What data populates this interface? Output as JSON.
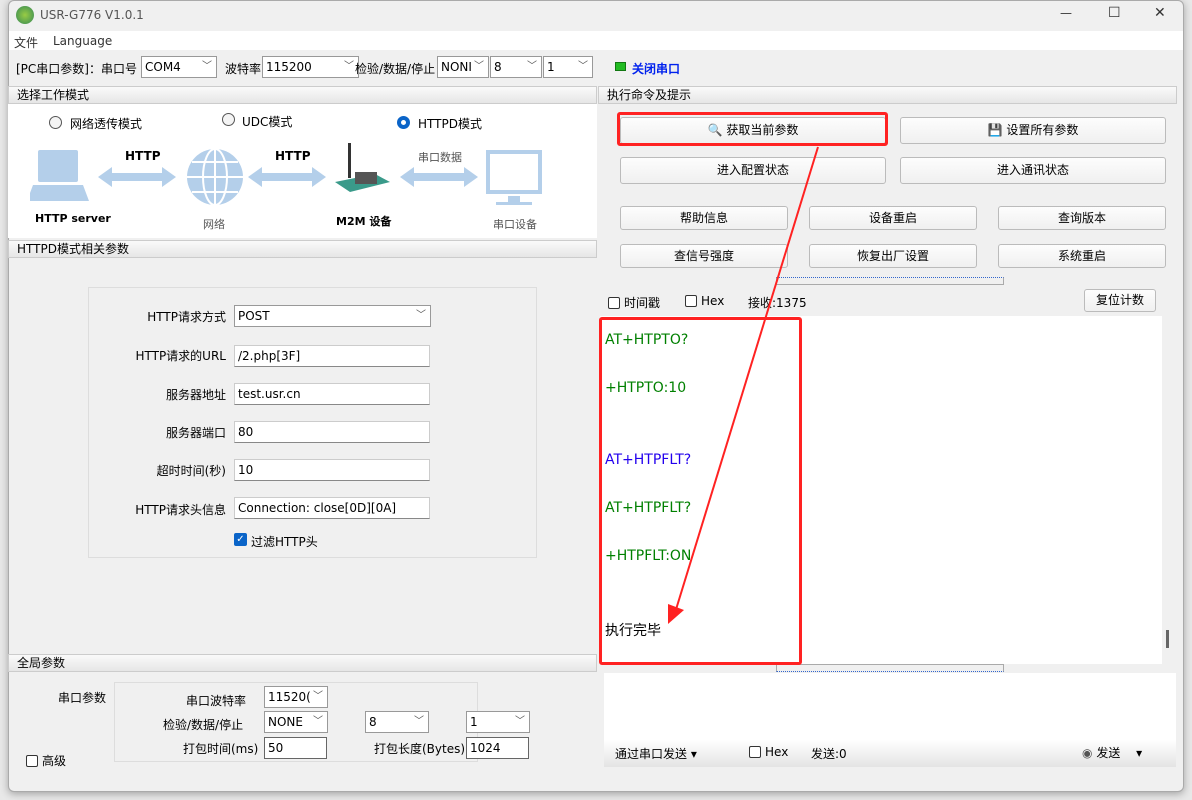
{
  "window": {
    "title": "USR-G776 V1.0.1",
    "controls": [
      "—",
      "☐",
      "✕"
    ]
  },
  "menu": [
    "文件",
    "Language"
  ],
  "toolbar": {
    "pc_label": "[PC串口参数]：串口号",
    "port": "COM4",
    "baud_label": "波特率",
    "baud": "115200",
    "parity_label": "检验/数据/停止",
    "parity": "NONI",
    "data_bits": "8",
    "stop_bits": "1",
    "close_port": "关闭串口",
    "status_color": "#22bb22"
  },
  "mode": {
    "header": "选择工作模式",
    "options": [
      "网络透传模式",
      "UDC模式",
      "HTTPD模式"
    ],
    "selected": "HTTPD模式",
    "diagram": {
      "http1": "HTTP",
      "http2": "HTTP",
      "serial": "串口数据",
      "server": "HTTP server",
      "network": "网络",
      "m2m": "M2M 设备",
      "device": "串口设备"
    }
  },
  "httpd": {
    "header": "HTTPD模式相关参数",
    "fields": [
      {
        "label": "HTTP请求方式",
        "value": "POST",
        "type": "select"
      },
      {
        "label": "HTTP请求的URL",
        "value": "/2.php[3F]"
      },
      {
        "label": "服务器地址",
        "value": "test.usr.cn"
      },
      {
        "label": "服务器端口",
        "value": "80"
      },
      {
        "label": "超时时间(秒)",
        "value": "10"
      },
      {
        "label": "HTTP请求头信息",
        "value": "Connection: close[0D][0A]"
      }
    ],
    "filter_label": "过滤HTTP头",
    "filter_checked": true
  },
  "global": {
    "header": "全局参数",
    "serial_label": "串口参数",
    "baud_label": "串口波特率",
    "baud": "11520(",
    "parity_label": "检验/数据/停止",
    "parity": "NONE",
    "data_bits": "8",
    "stop_bits": "1",
    "pack_time_label": "打包时间(ms)",
    "pack_time": "50",
    "pack_len_label": "打包长度(Bytes)",
    "pack_len": "1024",
    "advanced": "高级"
  },
  "commands": {
    "header": "执行命令及提示",
    "get_params": "获取当前参数",
    "set_params": "设置所有参数",
    "enter_config": "进入配置状态",
    "enter_comm": "进入通讯状态",
    "help": "帮助信息",
    "restart_device": "设备重启",
    "query_version": "查询版本",
    "signal": "查信号强度",
    "factory_reset": "恢复出厂设置",
    "system_restart": "系统重启"
  },
  "receive": {
    "timestamp": "时间戳",
    "hex": "Hex",
    "count": "接收:1375",
    "reset": "复位计数",
    "lines": [
      {
        "text": "AT+HTPTO?",
        "color": "#008000"
      },
      {
        "text": "+HTPTO:10",
        "color": "#008000"
      },
      {
        "text": "AT+HTPFLT?",
        "color": "#2200ee"
      },
      {
        "text": "AT+HTPFLT?",
        "color": "#008000"
      },
      {
        "text": "+HTPFLT:ON",
        "color": "#008000"
      },
      {
        "text": "执行完毕",
        "color": "#000000"
      }
    ]
  },
  "send": {
    "via": "通过串口发送",
    "hex": "Hex",
    "count": "发送:0",
    "send": "发送"
  },
  "annotation_color": "#ff2222"
}
